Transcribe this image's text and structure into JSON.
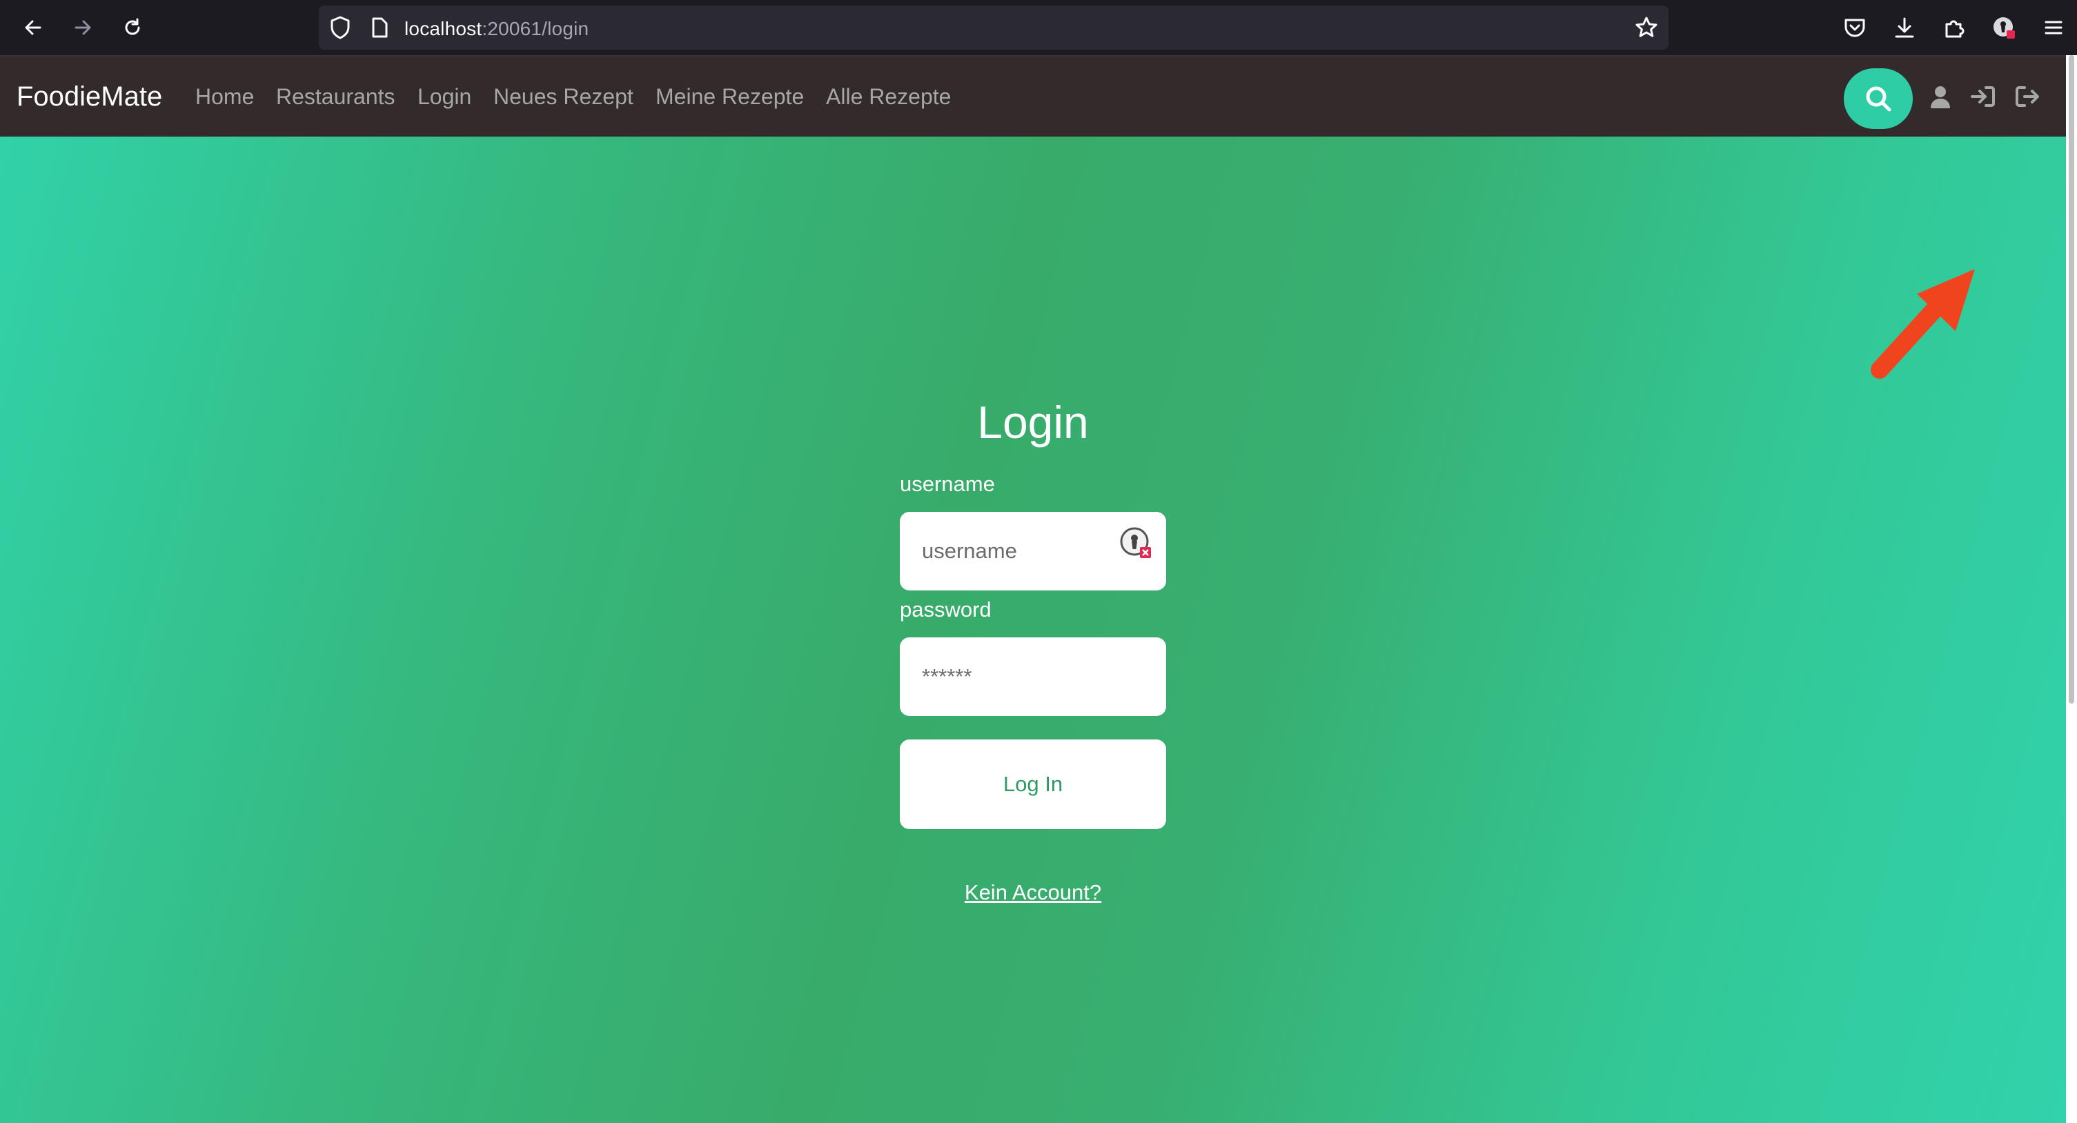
{
  "browser": {
    "url_host": "localhost",
    "url_rest": ":20061/login"
  },
  "navbar": {
    "brand": "FoodieMate",
    "links": [
      "Home",
      "Restaurants",
      "Login",
      "Neues Rezept",
      "Meine Rezepte",
      "Alle Rezepte"
    ],
    "icons": [
      "search-icon",
      "user-icon",
      "sign-in-icon",
      "sign-out-icon"
    ]
  },
  "login": {
    "title": "Login",
    "username_label": "username",
    "username_placeholder": "username",
    "password_label": "password",
    "password_placeholder": "******",
    "submit_label": "Log In",
    "signup_link": "Kein Account?"
  },
  "colors": {
    "navbar_bg": "#322a2b",
    "accent": "#2ecda6",
    "button_text": "#2f9a63",
    "annotation_arrow": "#f0441f"
  }
}
